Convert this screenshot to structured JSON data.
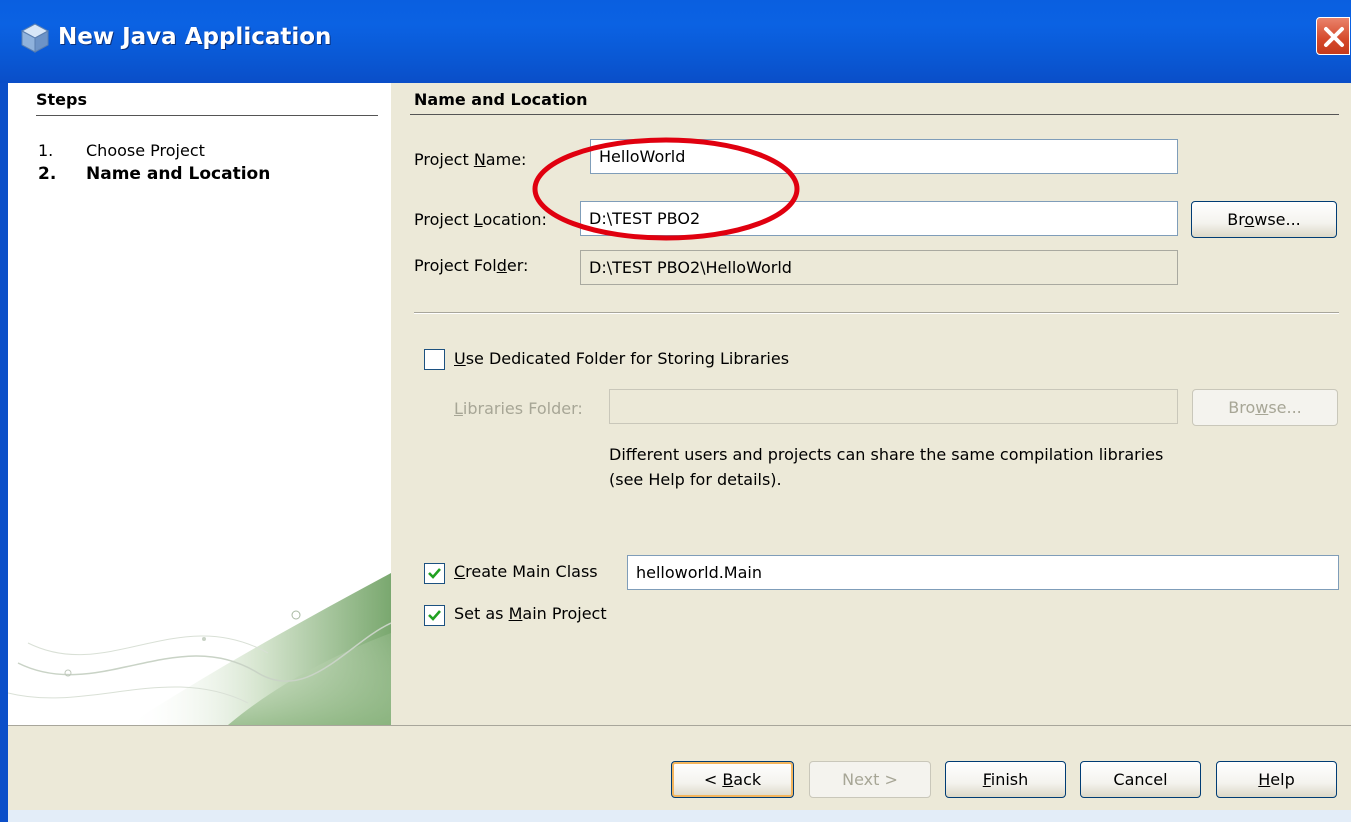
{
  "window": {
    "title": "New Java Application",
    "icon": "java-cup-icon",
    "close_icon": "close-icon"
  },
  "steps": {
    "heading": "Steps",
    "items": [
      {
        "num": "1.",
        "label": "Choose Project",
        "active": false
      },
      {
        "num": "2.",
        "label": "Name and Location",
        "active": true
      }
    ]
  },
  "section": {
    "heading": "Name and Location"
  },
  "form": {
    "project_name_label_a": "Project ",
    "project_name_label_u": "N",
    "project_name_label_b": "ame:",
    "project_name_value": "HelloWorld",
    "project_location_label_a": "Project ",
    "project_location_label_u": "L",
    "project_location_label_b": "ocation:",
    "project_location_value": "D:\\TEST PBO2",
    "project_folder_label_a": "Project Fol",
    "project_folder_label_u": "d",
    "project_folder_label_b": "er:",
    "project_folder_value": "D:\\TEST PBO2\\HelloWorld",
    "browse_a": "Br",
    "browse_u": "o",
    "browse_b": "wse...",
    "dedicated_folder_u": "U",
    "dedicated_folder_rest": "se Dedicated Folder for Storing Libraries",
    "dedicated_folder_checked": false,
    "libraries_folder_u": "L",
    "libraries_folder_rest": "ibraries Folder:",
    "libraries_folder_value": "",
    "browse2_a": "Bro",
    "browse2_u": "w",
    "browse2_b": "se...",
    "hint": "Different users and projects can share the same compilation libraries (see Help for details).",
    "create_main_u": "C",
    "create_main_rest": "reate Main Class",
    "create_main_checked": true,
    "main_class_value": "helloworld.Main",
    "set_main_a": "Set as ",
    "set_main_u": "M",
    "set_main_b": "ain Project",
    "set_main_checked": true
  },
  "buttons": {
    "back_a": "< ",
    "back_u": "B",
    "back_b": "ack",
    "next": "Next >",
    "finish_u": "F",
    "finish_b": "inish",
    "cancel": "Cancel",
    "help_u": "H",
    "help_b": "elp"
  },
  "colors": {
    "titlebar": "#0a5fe0",
    "dialog_bg": "#ece9d8",
    "annotation": "#e0000f",
    "close_button": "#d5492b"
  }
}
